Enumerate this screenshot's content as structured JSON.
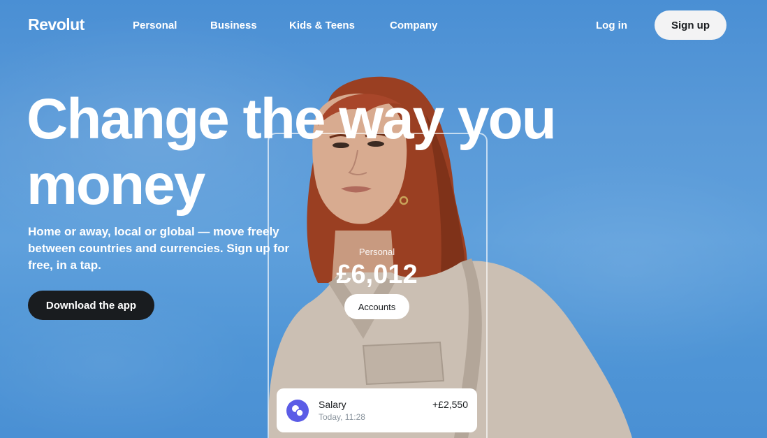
{
  "nav": {
    "logo": "Revolut",
    "links": [
      "Personal",
      "Business",
      "Kids & Teens",
      "Company"
    ],
    "login": "Log in",
    "signup": "Sign up"
  },
  "hero": {
    "title": "Change the way you money",
    "subtitle": "Home or away, local or global — move freely between countries and currencies. Sign up for free, in a tap.",
    "cta": "Download the app"
  },
  "phone": {
    "account_label": "Personal",
    "balance": "£6,012",
    "accounts_button": "Accounts",
    "transaction": {
      "title": "Salary",
      "time": "Today, 11:28",
      "amount": "+£2,550",
      "icon": "coins-icon"
    }
  },
  "colors": {
    "sky": "#5a9ad8",
    "dark_button": "#191c1f",
    "light_button": "#f3f3f4",
    "transaction_icon": "#5b5ce6"
  }
}
